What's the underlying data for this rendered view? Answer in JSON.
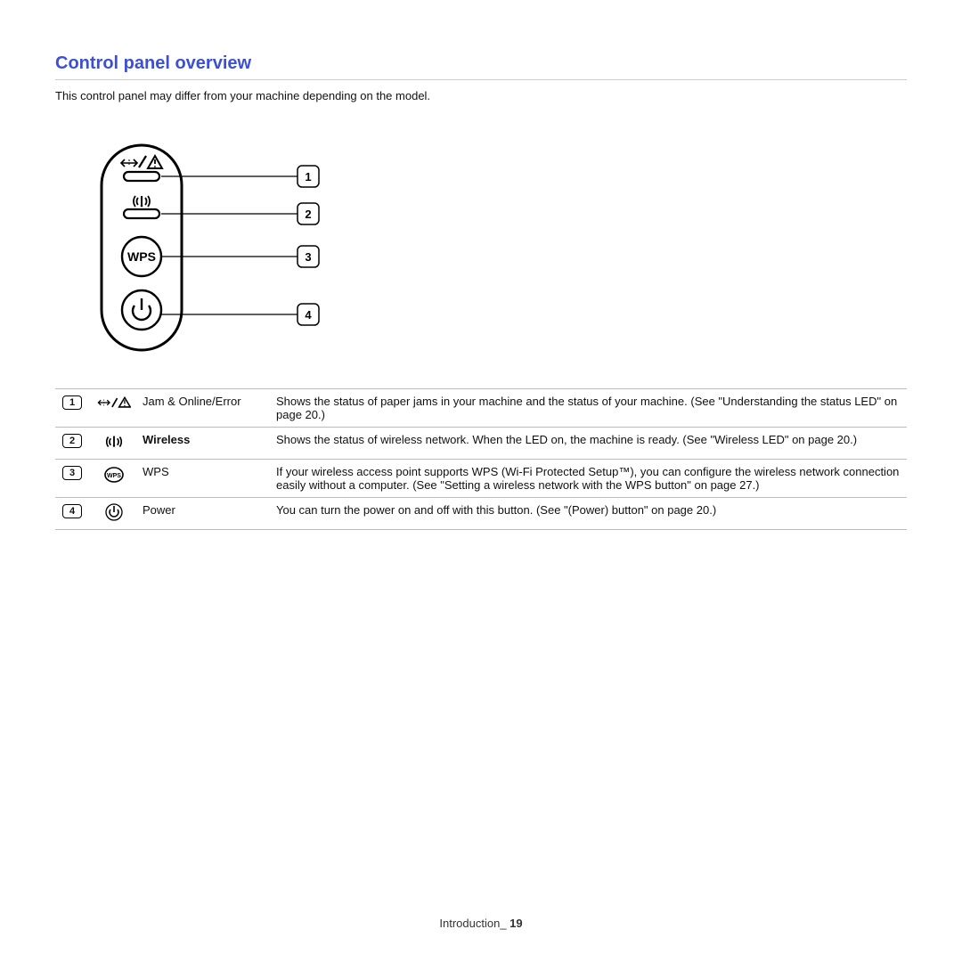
{
  "section_title": "Control panel overview",
  "intro": "This control panel may differ from your machine depending on the model.",
  "diagram_callouts": [
    "1",
    "2",
    "3",
    "4"
  ],
  "diagram_wps_label": "WPS",
  "rows": [
    {
      "num": "1",
      "icon": "jam-error-icon",
      "label": "Jam & Online/Error",
      "desc": "Shows the status of paper jams in your machine and the status of your machine. (See \"Understanding the status LED\" on page 20.)"
    },
    {
      "num": "2",
      "icon": "wireless-icon",
      "label": "Wireless",
      "label_bold": true,
      "desc": "Shows the status of wireless network. When the LED on, the machine is ready. (See \"Wireless LED\" on page 20.)"
    },
    {
      "num": "3",
      "icon": "wps-icon",
      "label": "WPS",
      "desc": "If your wireless access point supports WPS (Wi-Fi Protected Setup™), you can configure the wireless network connection easily without a computer. (See \"Setting a wireless network with the WPS button\" on page 27.)"
    },
    {
      "num": "4",
      "icon": "power-icon",
      "label": "Power",
      "desc": "You can turn the power on and off with this button. (See \"(Power) button\" on page 20.)"
    }
  ],
  "footer_chapter": "Introduction",
  "footer_separator": "_ ",
  "footer_page": "19"
}
